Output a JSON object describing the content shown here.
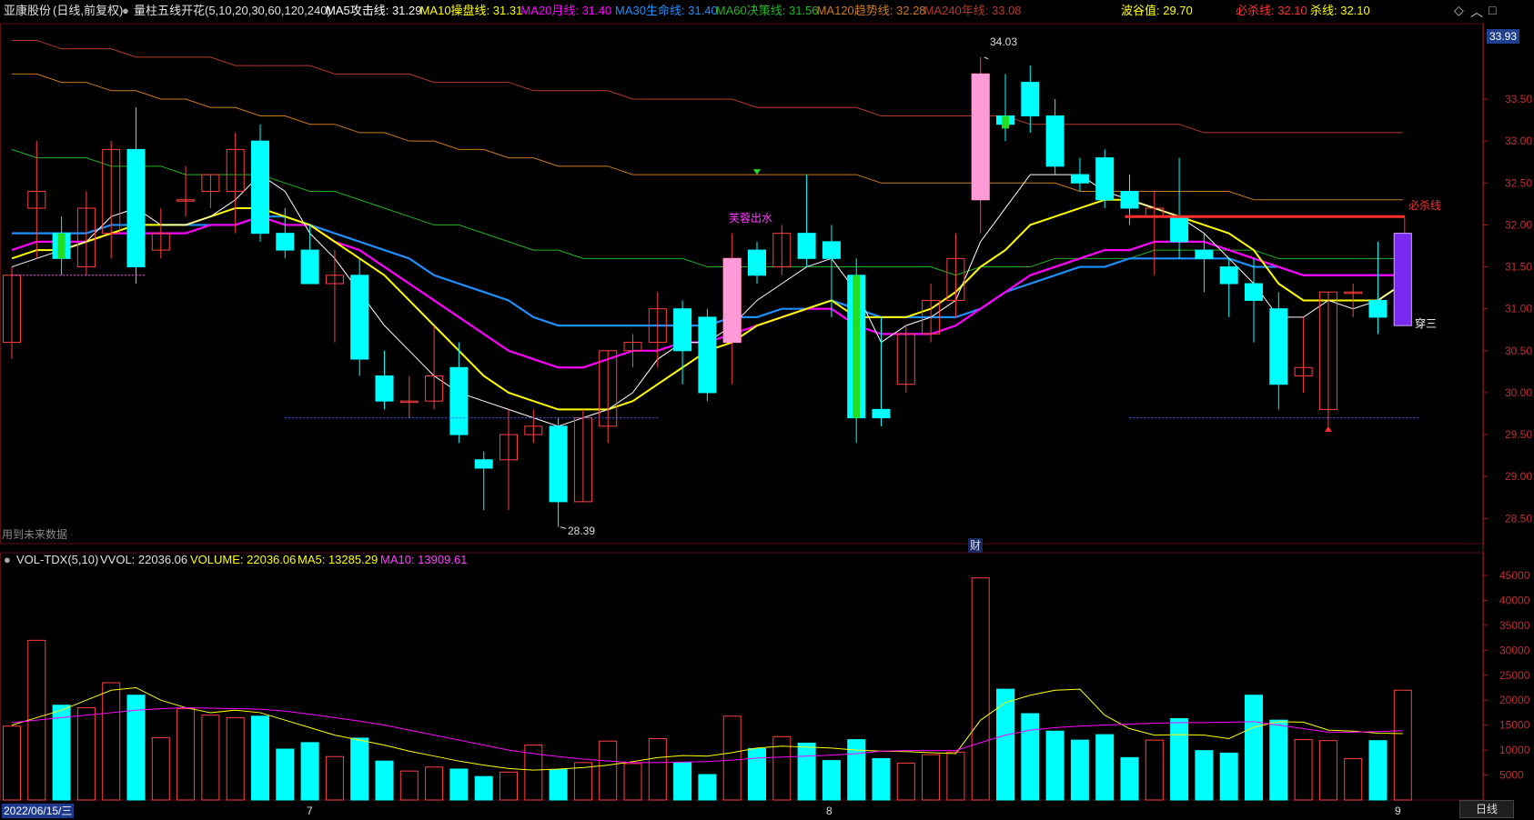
{
  "header": {
    "stock_name": "亚康股份",
    "period": "(日线,前复权)",
    "indicator": "量柱五线开花(5,10,20,30,60,120,240)",
    "items": [
      {
        "label": "MA5攻击线: 31.29",
        "color": "#ffffff"
      },
      {
        "label": "MA10操盘线: 31.31",
        "color": "#ffff00"
      },
      {
        "label": "MA20月线: 31.40",
        "color": "#ff00ff"
      },
      {
        "label": "MA30生命线: 31.40",
        "color": "#1e90ff"
      },
      {
        "label": "MA60决策线: 31.56",
        "color": "#22b422"
      },
      {
        "label": "MA120趋势线: 32.28",
        "color": "#cc7a1e"
      },
      {
        "label": "MA240年线: 33.08",
        "color": "#b33a2a"
      }
    ],
    "wave_label": "波谷值: 29.70",
    "kill_label": "必杀线: 32.10",
    "kill2_label": "杀线: 32.10"
  },
  "colors": {
    "up": "#ff4040",
    "down": "#00ffff",
    "ma5": "#ffffff",
    "ma10": "#ffff00",
    "ma20": "#ff00ff",
    "ma30": "#1e90ff",
    "ma60": "#22b422",
    "ma120": "#cc7a1e",
    "ma240": "#b33a2a"
  },
  "annotations": {
    "high_label": "34.03",
    "low_label": "28.39",
    "future_label": "用到未来数据",
    "fin_label": "财",
    "lotus_label": "芙蓉出水",
    "kill_line_label": "必杀线",
    "chuan_label": "穿三",
    "current_price": "33.93"
  },
  "volume_header": {
    "name": "VOL-TDX(5,10)",
    "vvol": "VVOL: 22036.06",
    "volume": "VOLUME: 22036.06",
    "ma5": "MA5: 13285.29",
    "ma10": "MA10: 13909.61"
  },
  "xaxis": {
    "start_date": "2022/06/15/三",
    "months": [
      "7",
      "8",
      "9"
    ],
    "tab_label": "日线"
  },
  "chart_data": {
    "type": "candlestick",
    "price_ticks": [
      28.5,
      29.0,
      29.5,
      30.0,
      30.5,
      31.0,
      31.5,
      32.0,
      32.5,
      33.0,
      33.5
    ],
    "price_tick_labels": [
      "28.50",
      "29.00",
      "29.50",
      "30.00",
      "30.50",
      "31.00",
      "31.50",
      "32.00",
      "32.50",
      "33.00",
      "33.50"
    ],
    "volume_ticks": [
      5000,
      10000,
      15000,
      20000,
      25000,
      30000,
      35000,
      40000,
      45000
    ],
    "volume_tick_labels": [
      "5000",
      "10000",
      "15000",
      "20000",
      "25000",
      "30000",
      "35000",
      "40000",
      "45000"
    ],
    "ylim": [
      28.2,
      34.4
    ],
    "vol_ylim": [
      0,
      47000
    ],
    "candles": [
      {
        "o": 30.6,
        "h": 31.5,
        "l": 30.4,
        "c": 31.4,
        "v": 14800
      },
      {
        "o": 32.2,
        "h": 33.0,
        "l": 31.6,
        "c": 32.4,
        "v": 32000
      },
      {
        "o": 31.9,
        "h": 32.1,
        "l": 31.4,
        "c": 31.6,
        "v": 19000
      },
      {
        "o": 31.5,
        "h": 32.4,
        "l": 31.4,
        "c": 32.2,
        "v": 18500
      },
      {
        "o": 31.9,
        "h": 33.0,
        "l": 31.6,
        "c": 32.9,
        "v": 23500
      },
      {
        "o": 32.9,
        "h": 33.4,
        "l": 31.3,
        "c": 31.5,
        "v": 21000
      },
      {
        "o": 31.7,
        "h": 32.2,
        "l": 31.6,
        "c": 31.9,
        "v": 12500
      },
      {
        "o": 32.3,
        "h": 32.7,
        "l": 32.1,
        "c": 32.3,
        "v": 18300
      },
      {
        "o": 32.4,
        "h": 32.6,
        "l": 32.2,
        "c": 32.6,
        "v": 17000
      },
      {
        "o": 32.4,
        "h": 33.1,
        "l": 31.9,
        "c": 32.9,
        "v": 16500
      },
      {
        "o": 33.0,
        "h": 33.2,
        "l": 31.8,
        "c": 31.9,
        "v": 16800
      },
      {
        "o": 31.9,
        "h": 32.2,
        "l": 31.6,
        "c": 31.7,
        "v": 10200
      },
      {
        "o": 31.7,
        "h": 32.0,
        "l": 31.3,
        "c": 31.3,
        "v": 11500
      },
      {
        "o": 31.3,
        "h": 31.7,
        "l": 30.6,
        "c": 31.4,
        "v": 8700
      },
      {
        "o": 31.4,
        "h": 31.6,
        "l": 30.2,
        "c": 30.4,
        "v": 12400
      },
      {
        "o": 30.2,
        "h": 30.5,
        "l": 29.8,
        "c": 29.9,
        "v": 7800
      },
      {
        "o": 29.9,
        "h": 30.2,
        "l": 29.7,
        "c": 29.9,
        "v": 5800
      },
      {
        "o": 29.9,
        "h": 30.8,
        "l": 29.8,
        "c": 30.2,
        "v": 6600
      },
      {
        "o": 30.3,
        "h": 30.6,
        "l": 29.4,
        "c": 29.5,
        "v": 6200
      },
      {
        "o": 29.2,
        "h": 29.3,
        "l": 28.6,
        "c": 29.1,
        "v": 4700
      },
      {
        "o": 29.2,
        "h": 29.8,
        "l": 28.6,
        "c": 29.5,
        "v": 5600
      },
      {
        "o": 29.5,
        "h": 29.8,
        "l": 29.4,
        "c": 29.6,
        "v": 11000
      },
      {
        "o": 29.6,
        "h": 29.7,
        "l": 28.4,
        "c": 28.7,
        "v": 6100
      },
      {
        "o": 28.7,
        "h": 29.8,
        "l": 28.7,
        "c": 29.7,
        "v": 7500
      },
      {
        "o": 29.6,
        "h": 30.5,
        "l": 29.4,
        "c": 30.5,
        "v": 11800
      },
      {
        "o": 30.5,
        "h": 30.7,
        "l": 30.3,
        "c": 30.6,
        "v": 7300
      },
      {
        "o": 30.6,
        "h": 31.2,
        "l": 30.3,
        "c": 31.0,
        "v": 12300
      },
      {
        "o": 31.0,
        "h": 31.1,
        "l": 30.1,
        "c": 30.5,
        "v": 7500
      },
      {
        "o": 30.9,
        "h": 31.0,
        "l": 29.9,
        "c": 30.0,
        "v": 5100
      },
      {
        "o": 30.6,
        "h": 31.9,
        "l": 30.1,
        "c": 31.6,
        "v": 16800
      },
      {
        "o": 31.7,
        "h": 31.8,
        "l": 31.3,
        "c": 31.4,
        "v": 10300
      },
      {
        "o": 31.5,
        "h": 32.0,
        "l": 31.4,
        "c": 31.9,
        "v": 12700
      },
      {
        "o": 31.9,
        "h": 32.6,
        "l": 31.5,
        "c": 31.6,
        "v": 11400
      },
      {
        "o": 31.8,
        "h": 32.0,
        "l": 30.9,
        "c": 31.6,
        "v": 7900
      },
      {
        "o": 31.4,
        "h": 31.6,
        "l": 29.4,
        "c": 29.7,
        "v": 12100
      },
      {
        "o": 29.8,
        "h": 30.9,
        "l": 29.6,
        "c": 29.7,
        "v": 8300
      },
      {
        "o": 30.1,
        "h": 30.8,
        "l": 30.0,
        "c": 30.7,
        "v": 7400
      },
      {
        "o": 30.7,
        "h": 31.3,
        "l": 30.6,
        "c": 31.1,
        "v": 9100
      },
      {
        "o": 31.1,
        "h": 31.9,
        "l": 30.9,
        "c": 31.6,
        "v": 9600
      },
      {
        "o": 32.3,
        "h": 34.0,
        "l": 31.9,
        "c": 33.8,
        "v": 44500
      },
      {
        "o": 33.3,
        "h": 33.8,
        "l": 33.0,
        "c": 33.2,
        "v": 22200
      },
      {
        "o": 33.7,
        "h": 33.9,
        "l": 33.1,
        "c": 33.3,
        "v": 17300
      },
      {
        "o": 33.3,
        "h": 33.5,
        "l": 32.6,
        "c": 32.7,
        "v": 13800
      },
      {
        "o": 32.6,
        "h": 32.8,
        "l": 32.4,
        "c": 32.5,
        "v": 12000
      },
      {
        "o": 32.8,
        "h": 32.9,
        "l": 32.2,
        "c": 32.3,
        "v": 13100
      },
      {
        "o": 32.4,
        "h": 32.6,
        "l": 32.0,
        "c": 32.2,
        "v": 8500
      },
      {
        "o": 32.1,
        "h": 32.4,
        "l": 31.4,
        "c": 32.2,
        "v": 12000
      },
      {
        "o": 32.1,
        "h": 32.8,
        "l": 31.6,
        "c": 31.8,
        "v": 16300
      },
      {
        "o": 31.7,
        "h": 31.9,
        "l": 31.2,
        "c": 31.6,
        "v": 9900
      },
      {
        "o": 31.5,
        "h": 31.6,
        "l": 30.9,
        "c": 31.3,
        "v": 9400
      },
      {
        "o": 31.3,
        "h": 31.6,
        "l": 30.6,
        "c": 31.1,
        "v": 21000
      },
      {
        "o": 31.0,
        "h": 31.2,
        "l": 29.8,
        "c": 30.1,
        "v": 16000
      },
      {
        "o": 30.2,
        "h": 30.9,
        "l": 30.0,
        "c": 30.3,
        "v": 12100
      },
      {
        "o": 29.8,
        "h": 31.2,
        "l": 29.6,
        "c": 31.2,
        "v": 11900
      },
      {
        "o": 31.2,
        "h": 31.3,
        "l": 30.9,
        "c": 31.2,
        "v": 8300
      },
      {
        "o": 31.1,
        "h": 31.8,
        "l": 30.7,
        "c": 30.9,
        "v": 11900
      },
      {
        "o": 30.8,
        "h": 31.9,
        "l": 30.8,
        "c": 31.9,
        "v": 22000
      }
    ],
    "ma_series": {
      "ma5": [
        31.5,
        31.6,
        31.7,
        31.8,
        32.1,
        32.2,
        32.0,
        32.0,
        32.1,
        32.3,
        32.6,
        32.4,
        31.9,
        31.6,
        31.2,
        30.8,
        30.5,
        30.2,
        30.0,
        29.9,
        29.8,
        29.7,
        29.6,
        29.7,
        29.8,
        30.0,
        30.4,
        30.6,
        30.6,
        30.8,
        31.1,
        31.3,
        31.5,
        31.6,
        31.2,
        30.6,
        30.8,
        30.9,
        31.1,
        31.8,
        32.2,
        32.6,
        32.6,
        32.6,
        32.4,
        32.3,
        32.2,
        32.1,
        31.9,
        31.6,
        31.3,
        30.9,
        30.9,
        31.1,
        31.0,
        31.1,
        31.3
      ],
      "ma10": [
        31.6,
        31.7,
        31.7,
        31.8,
        31.9,
        32.0,
        32.0,
        32.0,
        32.1,
        32.2,
        32.2,
        32.1,
        32.0,
        31.8,
        31.6,
        31.4,
        31.1,
        30.8,
        30.5,
        30.2,
        30.0,
        29.9,
        29.8,
        29.8,
        29.8,
        29.9,
        30.1,
        30.3,
        30.5,
        30.6,
        30.8,
        30.9,
        31.0,
        31.1,
        30.9,
        30.9,
        30.9,
        31.0,
        31.2,
        31.5,
        31.7,
        32.0,
        32.1,
        32.2,
        32.3,
        32.3,
        32.2,
        32.1,
        32.0,
        31.9,
        31.7,
        31.3,
        31.1,
        31.1,
        31.1,
        31.1,
        31.3
      ],
      "ma20": [
        31.7,
        31.8,
        31.8,
        31.8,
        31.9,
        31.9,
        31.9,
        31.9,
        32.0,
        32.0,
        32.1,
        32.0,
        32.0,
        31.8,
        31.7,
        31.5,
        31.3,
        31.1,
        30.9,
        30.7,
        30.5,
        30.4,
        30.3,
        30.3,
        30.4,
        30.5,
        30.5,
        30.6,
        30.6,
        30.7,
        30.8,
        30.9,
        31.0,
        31.0,
        30.8,
        30.7,
        30.7,
        30.7,
        30.8,
        31.0,
        31.2,
        31.4,
        31.5,
        31.6,
        31.7,
        31.7,
        31.8,
        31.8,
        31.8,
        31.7,
        31.6,
        31.5,
        31.4,
        31.4,
        31.4,
        31.4,
        31.4
      ],
      "ma30": [
        31.9,
        31.9,
        31.9,
        31.9,
        32.0,
        32.0,
        32.0,
        32.0,
        32.0,
        32.0,
        32.1,
        32.1,
        32.0,
        31.9,
        31.8,
        31.7,
        31.6,
        31.4,
        31.3,
        31.2,
        31.1,
        30.9,
        30.8,
        30.8,
        30.8,
        30.8,
        30.8,
        30.8,
        30.8,
        30.9,
        30.9,
        31.0,
        31.0,
        31.1,
        31.0,
        30.9,
        30.9,
        30.9,
        30.9,
        31.0,
        31.2,
        31.3,
        31.4,
        31.5,
        31.5,
        31.6,
        31.6,
        31.6,
        31.6,
        31.6,
        31.5,
        31.5,
        31.4,
        31.4,
        31.4,
        31.4,
        31.4
      ],
      "ma60": [
        32.9,
        32.8,
        32.8,
        32.8,
        32.7,
        32.7,
        32.7,
        32.6,
        32.6,
        32.6,
        32.6,
        32.5,
        32.4,
        32.4,
        32.3,
        32.2,
        32.1,
        32.0,
        32.0,
        31.9,
        31.8,
        31.7,
        31.7,
        31.6,
        31.6,
        31.6,
        31.6,
        31.6,
        31.5,
        31.5,
        31.5,
        31.5,
        31.5,
        31.5,
        31.5,
        31.5,
        31.5,
        31.5,
        31.4,
        31.5,
        31.5,
        31.5,
        31.6,
        31.6,
        31.6,
        31.6,
        31.7,
        31.7,
        31.7,
        31.7,
        31.7,
        31.6,
        31.6,
        31.6,
        31.6,
        31.6,
        31.6
      ],
      "ma120": [
        33.8,
        33.8,
        33.7,
        33.7,
        33.6,
        33.6,
        33.5,
        33.5,
        33.4,
        33.4,
        33.3,
        33.3,
        33.2,
        33.2,
        33.1,
        33.1,
        33.0,
        33.0,
        32.9,
        32.9,
        32.8,
        32.8,
        32.7,
        32.7,
        32.7,
        32.6,
        32.6,
        32.6,
        32.6,
        32.6,
        32.6,
        32.6,
        32.6,
        32.6,
        32.6,
        32.5,
        32.5,
        32.5,
        32.5,
        32.5,
        32.5,
        32.5,
        32.5,
        32.4,
        32.4,
        32.4,
        32.4,
        32.4,
        32.4,
        32.4,
        32.3,
        32.3,
        32.3,
        32.3,
        32.3,
        32.3,
        32.3
      ],
      "ma240": [
        34.2,
        34.2,
        34.1,
        34.1,
        34.1,
        34.0,
        34.0,
        34.0,
        34.0,
        33.9,
        33.9,
        33.9,
        33.9,
        33.8,
        33.8,
        33.8,
        33.8,
        33.7,
        33.7,
        33.7,
        33.7,
        33.6,
        33.6,
        33.6,
        33.6,
        33.5,
        33.5,
        33.5,
        33.5,
        33.5,
        33.4,
        33.4,
        33.4,
        33.4,
        33.4,
        33.3,
        33.3,
        33.3,
        33.3,
        33.3,
        33.3,
        33.2,
        33.2,
        33.2,
        33.2,
        33.2,
        33.2,
        33.2,
        33.1,
        33.1,
        33.1,
        33.1,
        33.1,
        33.1,
        33.1,
        33.1,
        33.1
      ]
    },
    "vol_ma5": [
      15000,
      16500,
      18000,
      20000,
      22000,
      22500,
      20000,
      18500,
      17500,
      18000,
      17500,
      16000,
      14500,
      13000,
      12000,
      11000,
      9800,
      8800,
      7800,
      7000,
      6300,
      6000,
      6200,
      6500,
      7000,
      7700,
      8500,
      8900,
      8800,
      9500,
      10400,
      10800,
      10600,
      10400,
      10000,
      9800,
      9700,
      9500,
      9300,
      16000,
      19500,
      21000,
      22000,
      22200,
      17000,
      14300,
      13000,
      13100,
      13000,
      12300,
      14600,
      15700,
      15600,
      14000,
      13800,
      13400,
      13300
    ],
    "vol_ma10": [
      15500,
      16000,
      16500,
      17000,
      17500,
      18000,
      18300,
      18500,
      18400,
      18300,
      18200,
      17800,
      17200,
      16500,
      15800,
      15000,
      14000,
      13000,
      12000,
      11000,
      10000,
      9300,
      8700,
      8200,
      7800,
      7500,
      7500,
      7600,
      7700,
      8000,
      8400,
      8600,
      8800,
      9000,
      9300,
      9800,
      9900,
      9900,
      9900,
      11500,
      13000,
      14000,
      14500,
      14800,
      15000,
      15200,
      15400,
      15500,
      15500,
      15600,
      15700,
      15000,
      14300,
      13600,
      13600,
      13700,
      13900
    ]
  }
}
